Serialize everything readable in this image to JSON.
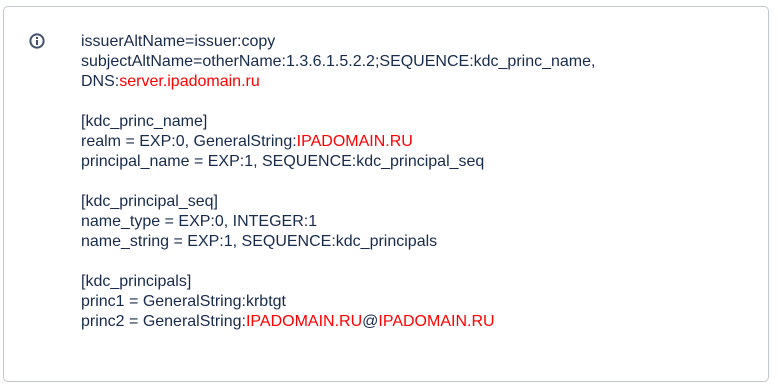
{
  "icon": {
    "name": "info-icon",
    "color": "#42526e"
  },
  "colors": {
    "text": "#172b4d",
    "highlight": "#ff0000",
    "border": "#c1c7d0"
  },
  "lines": {
    "l1": "issuerAltName=issuer:copy",
    "l2": "subjectAltName=otherName:1.3.6.1.5.2.2;SEQUENCE:kdc_princ_name,",
    "l3_prefix": "DNS:",
    "l3_value": "server.ipadomain.ru",
    "l4": "[kdc_princ_name]",
    "l5_prefix": "realm = EXP:0, GeneralString:",
    "l5_value": "IPADOMAIN.RU",
    "l6": "principal_name = EXP:1, SEQUENCE:kdc_principal_seq",
    "l7": "[kdc_principal_seq]",
    "l8": "name_type = EXP:0, INTEGER:1",
    "l9": "name_string = EXP:1, SEQUENCE:kdc_principals",
    "l10": "[kdc_principals]",
    "l11": "princ1 = GeneralString:krbtgt",
    "l12_prefix": "princ2 = GeneralString:",
    "l12_value1": "IPADOMAIN.RU",
    "l12_sep": "@",
    "l12_value2": "IPADOMAIN.RU"
  }
}
